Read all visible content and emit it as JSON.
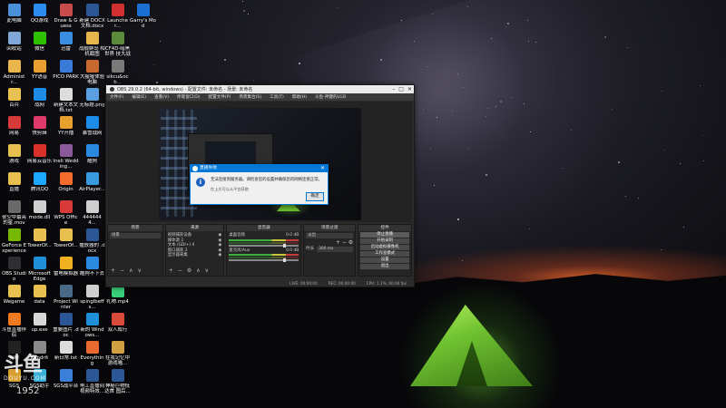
{
  "desktop": {
    "icons": [
      {
        "label": "此电脑",
        "icon": "computer-icon",
        "color": "#4a90d9",
        "col": 0,
        "row": 0
      },
      {
        "label": "QQ游戏",
        "icon": "qq-game-icon",
        "color": "#2d8cf0",
        "col": 1,
        "row": 0
      },
      {
        "label": "Draw & Guess",
        "icon": "draw-guess-icon",
        "color": "#c84c4c",
        "col": 2,
        "row": 0
      },
      {
        "label": "新建 DOCX 文档.docx",
        "icon": "word-doc-icon",
        "color": "#2b5797",
        "col": 3,
        "row": 0
      },
      {
        "label": "Launcher...",
        "icon": "launcher-icon",
        "color": "#d03030",
        "col": 4,
        "row": 0
      },
      {
        "label": "Garry's Mod",
        "icon": "garrys-mod-icon",
        "color": "#1a6fd0",
        "col": 5,
        "row": 0
      },
      {
        "label": "回收站",
        "icon": "recycle-bin-icon",
        "color": "#7fa8d8",
        "col": 0,
        "row": 1
      },
      {
        "label": "微信",
        "icon": "wechat-icon",
        "color": "#2dc100",
        "col": 1,
        "row": 1
      },
      {
        "label": "迅雷",
        "icon": "thunder-icon",
        "color": "#3a8de0",
        "col": 2,
        "row": 1
      },
      {
        "label": "战舰群岛 相机截图",
        "icon": "folder-icon",
        "color": "#e8b64c",
        "col": 3,
        "row": 1
      },
      {
        "label": "CF4D-暗黑世界 技大战",
        "icon": "game-icon",
        "color": "#5a8a3a",
        "col": 4,
        "row": 1
      },
      {
        "label": "Administr...",
        "icon": "user-folder-icon",
        "color": "#e8b64c",
        "col": 0,
        "row": 2
      },
      {
        "label": "YY语音",
        "icon": "yy-icon",
        "color": "#e8a030",
        "col": 1,
        "row": 2
      },
      {
        "label": "PICO PARK",
        "icon": "pico-park-icon",
        "color": "#3a7ad8",
        "col": 2,
        "row": 2
      },
      {
        "label": "大猩猩体验 电脑",
        "icon": "app-icon",
        "color": "#c86a30",
        "col": 3,
        "row": 2
      },
      {
        "label": "sikcu&ocb...",
        "icon": "app-icon",
        "color": "#7a7a7a",
        "col": 4,
        "row": 2
      },
      {
        "label": "百兵",
        "icon": "folder-icon",
        "color": "#e8c050",
        "col": 0,
        "row": 3
      },
      {
        "label": "战网",
        "icon": "battlenet-icon",
        "color": "#1c8ce8",
        "col": 1,
        "row": 3
      },
      {
        "label": "新建文本文 档.txt",
        "icon": "text-file-icon",
        "color": "#dcdcdc",
        "col": 2,
        "row": 3
      },
      {
        "label": "无标题.png",
        "icon": "image-icon",
        "color": "#5aa0e0",
        "col": 3,
        "row": 3
      },
      {
        "label": "网易",
        "icon": "netease-icon",
        "color": "#d83a3a",
        "col": 0,
        "row": 4
      },
      {
        "label": "快剪辑",
        "icon": "quick-edit-icon",
        "color": "#e03a6a",
        "col": 1,
        "row": 4
      },
      {
        "label": "YY开播",
        "icon": "yy-live-icon",
        "color": "#e8a030",
        "col": 2,
        "row": 4
      },
      {
        "label": "暴雪战网",
        "icon": "blizzard-icon",
        "color": "#1c8ce8",
        "col": 3,
        "row": 4
      },
      {
        "label": "游戏",
        "icon": "folder-icon",
        "color": "#e8c050",
        "col": 0,
        "row": 5
      },
      {
        "label": "网易云音乐",
        "icon": "netease-music-icon",
        "color": "#d8302a",
        "col": 1,
        "row": 5
      },
      {
        "label": "Ineli Wedding...",
        "icon": "game-icon",
        "color": "#8a5a9a",
        "col": 2,
        "row": 5
      },
      {
        "label": "酷狗",
        "icon": "kugou-icon",
        "color": "#2a8ae0",
        "col": 3,
        "row": 5
      },
      {
        "label": "直播",
        "icon": "folder-icon",
        "color": "#e8c050",
        "col": 0,
        "row": 6
      },
      {
        "label": "腾讯QQ",
        "icon": "qq-icon",
        "color": "#1ea7ff",
        "col": 1,
        "row": 6
      },
      {
        "label": "Origin",
        "icon": "origin-icon",
        "color": "#f56c2d",
        "col": 2,
        "row": 6
      },
      {
        "label": "AirPlayer...",
        "icon": "airplayer-icon",
        "color": "#3a9ae0",
        "col": 3,
        "row": 6
      },
      {
        "label": "夜空中最亮 的星.mov",
        "icon": "video-icon",
        "color": "#6a6a6a",
        "col": 0,
        "row": 7
      },
      {
        "label": "mode.dll",
        "icon": "dll-file-icon",
        "color": "#cfcfcf",
        "col": 1,
        "row": 7
      },
      {
        "label": "WPS Office",
        "icon": "wps-icon",
        "color": "#d83a3a",
        "col": 2,
        "row": 7
      },
      {
        "label": "4444444...",
        "icon": "file-icon",
        "color": "#cfcfcf",
        "col": 3,
        "row": 7
      },
      {
        "label": "GeForce Experience",
        "icon": "geforce-icon",
        "color": "#76b900",
        "col": 0,
        "row": 8
      },
      {
        "label": "TowerOf...",
        "icon": "folder-icon",
        "color": "#e8c050",
        "col": 1,
        "row": 8
      },
      {
        "label": "TowerOf...",
        "icon": "folder-icon",
        "color": "#e8c050",
        "col": 2,
        "row": 8
      },
      {
        "label": "播放器的 .docx",
        "icon": "word-doc-icon",
        "color": "#2b5797",
        "col": 3,
        "row": 8
      },
      {
        "label": "OBS Studio",
        "icon": "obs-icon",
        "color": "#302e31",
        "col": 0,
        "row": 9
      },
      {
        "label": "Microsoft Edge",
        "icon": "edge-icon",
        "color": "#1e8fd8",
        "col": 1,
        "row": 9
      },
      {
        "label": "雷电模拟器",
        "icon": "ldplayer-icon",
        "color": "#f0b020",
        "col": 2,
        "row": 9
      },
      {
        "label": "酷狗不下去",
        "icon": "kugou-icon",
        "color": "#2a8ae0",
        "col": 3,
        "row": 9
      },
      {
        "label": "Wegame",
        "icon": "wegame-icon",
        "color": "#e8c050",
        "col": 0,
        "row": 10
      },
      {
        "label": "data",
        "icon": "folder-icon",
        "color": "#e8c050",
        "col": 1,
        "row": 10
      },
      {
        "label": "Project Winter",
        "icon": "project-winter-icon",
        "color": "#4a6a8a",
        "col": 2,
        "row": 10
      },
      {
        "label": "spinglbeffs...",
        "icon": "file-icon",
        "color": "#cfcfcf",
        "col": 3,
        "row": 10
      },
      {
        "label": "礼物.mp4",
        "icon": "video-icon",
        "color": "#3ad07a",
        "col": 4,
        "row": 10
      },
      {
        "label": "斗鱼直播伴侣",
        "icon": "douyu-icon",
        "color": "#f07a20",
        "col": 0,
        "row": 11
      },
      {
        "label": "up.exe",
        "icon": "exe-icon",
        "color": "#d8d8d8",
        "col": 1,
        "row": 11
      },
      {
        "label": "重要图片 .doc",
        "icon": "word-doc-icon",
        "color": "#2b5797",
        "col": 2,
        "row": 11
      },
      {
        "label": "新的 Windows...",
        "icon": "windows-icon",
        "color": "#1e8fd8",
        "col": 3,
        "row": 11
      },
      {
        "label": "双人成行",
        "icon": "game-icon",
        "color": "#d84a3a",
        "col": 4,
        "row": 11
      },
      {
        "label": "剪映",
        "icon": "capcut-icon",
        "color": "#222",
        "col": 0,
        "row": 12
      },
      {
        "label": "Kandrit",
        "icon": "app-icon",
        "color": "#8a8a8a",
        "col": 1,
        "row": 12
      },
      {
        "label": "新日常.txt",
        "icon": "text-file-icon",
        "color": "#dcdcdc",
        "col": 2,
        "row": 12
      },
      {
        "label": "Everything",
        "icon": "everything-icon",
        "color": "#e86a30",
        "col": 3,
        "row": 12
      },
      {
        "label": "在我记忆中 游戏喵...",
        "icon": "game-icon",
        "color": "#d0a040",
        "col": 4,
        "row": 12
      },
      {
        "label": "SGS",
        "icon": "sgs-icon",
        "color": "#d8a030",
        "col": 0,
        "row": 13
      },
      {
        "label": "SGS助手",
        "icon": "sgs-icon",
        "color": "#3ab0d8",
        "col": 1,
        "row": 13
      },
      {
        "label": "SGS战平台",
        "icon": "sgs-icon",
        "color": "#3a80d8",
        "col": 2,
        "row": 13
      },
      {
        "label": "电工直播间 视频特效...",
        "icon": "word-doc-icon",
        "color": "#2b5797",
        "col": 3,
        "row": 13
      },
      {
        "label": "神秘巨物抵 达首 图后...",
        "icon": "word-doc-icon",
        "color": "#2b5797",
        "col": 4,
        "row": 13
      }
    ]
  },
  "watermark": {
    "mark": "斗鱼",
    "sub": "DOUYU.COM",
    "room": "1952"
  },
  "obs": {
    "title": "OBS 29.0.2 (64-bit, windows) - 配置文件: 未命名 - 场景: 未命名",
    "menu": [
      "文件(F)",
      "编辑(E)",
      "查看(V)",
      "停靠窗口(D)",
      "配置文件(P)",
      "场景集合(S)",
      "工具(T)",
      "帮助(H)",
      "斗鱼-神键的LGD"
    ],
    "docks": {
      "scenes": {
        "title": "场景",
        "items": [
          "场景"
        ]
      },
      "sources": {
        "title": "来源",
        "items": [
          "视频捕获设备",
          "媒体源 2",
          "文本 (GDI+) 4",
          "窗口捕获 2",
          "显示器采集"
        ]
      },
      "mixer": {
        "title": "混音器",
        "tracks": [
          {
            "name": "桌面音频",
            "db": "0.0 dB"
          },
          {
            "name": "麦克风/Aux",
            "db": "0.0 dB"
          }
        ]
      },
      "transitions": {
        "title": "场景过渡",
        "type": "淡出",
        "duration_label": "时长",
        "duration": "300 ms"
      },
      "controls": {
        "title": "控件",
        "buttons": [
          "停止直播",
          "开始录制",
          "启动虚拟摄像机",
          "工作室模式",
          "设置",
          "退出"
        ]
      }
    },
    "status": [
      "LIVE: 00:00:00",
      "REC: 00:00:00",
      "CPU: 1.1%, 60.00 fps"
    ]
  },
  "dialog": {
    "title": "直播失败",
    "message": "无法连接到服务器。请检查您的设置并确保您的网络连接正常。",
    "sub": "在上方可以从平台获取",
    "ok": "确定"
  }
}
